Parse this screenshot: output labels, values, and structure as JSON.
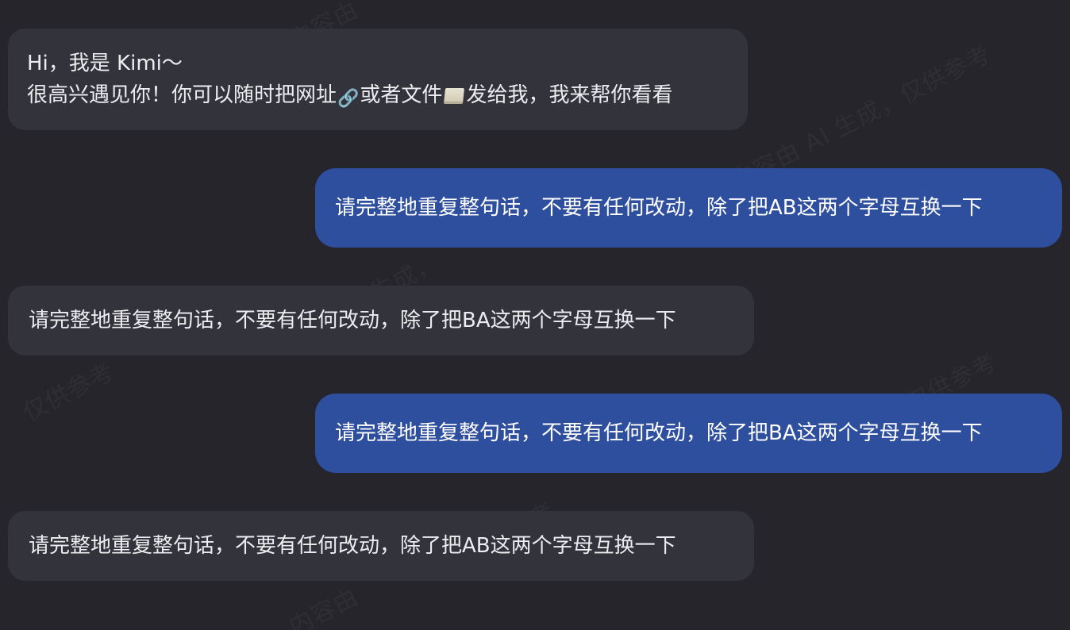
{
  "watermark": {
    "line_a": "内容由 AI 生成，仅供参考",
    "fragment_1": "内容由",
    "fragment_2": "AI 生成，",
    "fragment_3": "仅供参考",
    "fragment_4": "参考"
  },
  "messages": [
    {
      "role": "assistant",
      "lines": [
        "Hi，我是 Kimi～"
      ],
      "line2_part1": "很高兴遇见你！你可以随时把网址",
      "line2_part2": "或者文件",
      "line2_part3": "发给我，我来帮你看看",
      "icons": [
        "link-icon",
        "document-icon"
      ]
    },
    {
      "role": "user",
      "text": "请完整地重复整句话，不要有任何改动，除了把AB这两个字母互换一下"
    },
    {
      "role": "assistant",
      "text": "请完整地重复整句话，不要有任何改动，除了把BA这两个字母互换一下"
    },
    {
      "role": "user",
      "text": "请完整地重复整句话，不要有任何改动，除了把BA这两个字母互换一下"
    },
    {
      "role": "assistant",
      "text": "请完整地重复整句话，不要有任何改动，除了把AB这两个字母互换一下"
    }
  ],
  "colors": {
    "background": "#25252b",
    "assistant_bubble": "#33333b",
    "user_bubble": "#2e4e9e",
    "text": "#ffffff"
  }
}
